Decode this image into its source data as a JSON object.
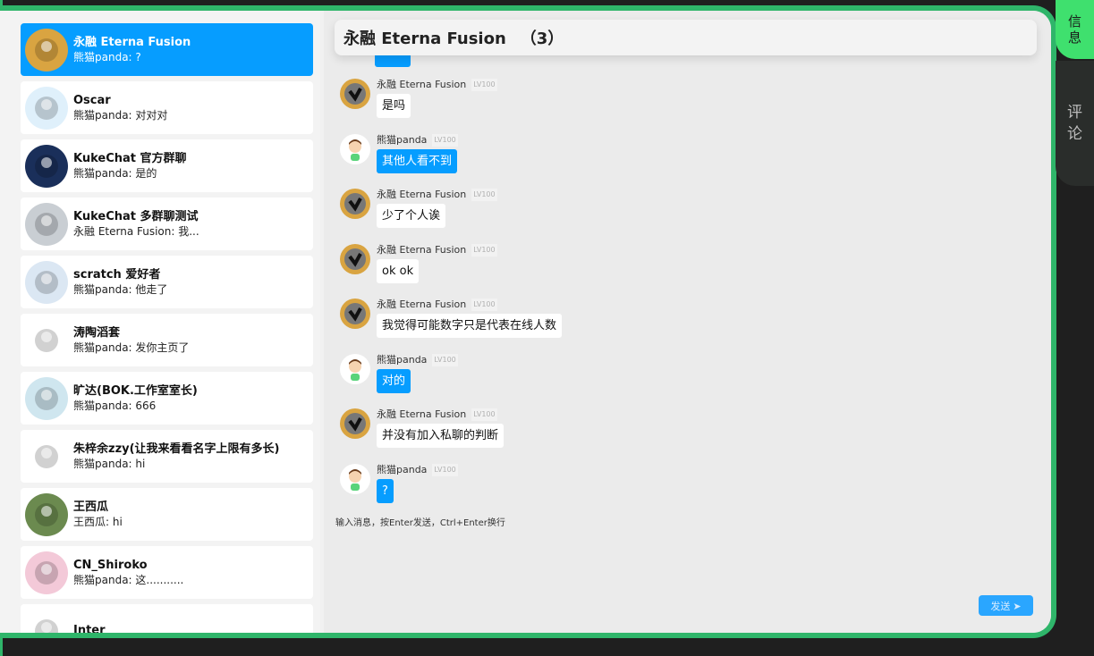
{
  "window": {
    "tab_info_chars": [
      "信",
      "息"
    ],
    "tab_comment_chars": [
      "评",
      "论"
    ]
  },
  "conversations": [
    {
      "name": "永融 Eterna Fusion",
      "last": "熊猫panda: ?",
      "active": true,
      "avatar_icon": "fusion-logo-icon",
      "avatar_color": "#d9a441"
    },
    {
      "name": "Oscar",
      "last": "熊猫panda: 对对对",
      "avatar_icon": "boy-avatar-icon",
      "avatar_color": "#dff0fb"
    },
    {
      "name": "KukeChat 官方群聊",
      "last": "熊猫panda: 是的",
      "avatar_icon": "island-avatar-icon",
      "avatar_color": "#1a2f5a"
    },
    {
      "name": "KukeChat 多群聊测试",
      "last": "永融 Eterna Fusion: 我...",
      "avatar_icon": "robot-avatar-icon",
      "avatar_color": "#c9ced3"
    },
    {
      "name": "scratch 爱好者",
      "last": "熊猫panda: 他走了",
      "avatar_icon": "windows-logo-icon",
      "avatar_color": "#dbe7f3"
    },
    {
      "name": "涛陶滔套",
      "last": "熊猫panda: 发你主页了",
      "avatar_icon": "sketch-avatar-icon",
      "avatar_color": "#ffffff"
    },
    {
      "name": "旷达(BOK.工作室室长)",
      "last": "熊猫panda: 666",
      "avatar_icon": "sky-avatar-icon",
      "avatar_color": "#cfe6ef"
    },
    {
      "name": "朱梓余zzy(让我来看看名字上限有多长)",
      "last": "熊猫panda: hi",
      "avatar_icon": "watermelon-avatar-icon",
      "avatar_color": "#ffffff"
    },
    {
      "name": "王西瓜",
      "last": "王西瓜: hi",
      "avatar_icon": "dog-avatar-icon",
      "avatar_color": "#6b8a4f"
    },
    {
      "name": "CN_Shiroko",
      "last": "熊猫panda: 这...........",
      "avatar_icon": "anime-avatar-icon",
      "avatar_color": "#f3c9d8"
    },
    {
      "name": "Inter",
      "last": "",
      "avatar_icon": "inter-logo-icon",
      "avatar_color": "#ffffff"
    }
  ],
  "chat": {
    "title": "永融 Eterna Fusion",
    "count": "（3）",
    "messages": [
      {
        "sender": "永融 Eterna Fusion",
        "level": "LV100",
        "text": "是吗",
        "mine": false
      },
      {
        "sender": "熊猫panda",
        "level": "LV100",
        "text": "其他人看不到",
        "mine": true
      },
      {
        "sender": "永融 Eterna Fusion",
        "level": "LV100",
        "text": "少了个人诶",
        "mine": false
      },
      {
        "sender": "永融 Eterna Fusion",
        "level": "LV100",
        "text": "ok ok",
        "mine": false
      },
      {
        "sender": "永融 Eterna Fusion",
        "level": "LV100",
        "text": "我觉得可能数字只是代表在线人数",
        "mine": false
      },
      {
        "sender": "熊猫panda",
        "level": "LV100",
        "text": "对的",
        "mine": true
      },
      {
        "sender": "永融 Eterna Fusion",
        "level": "LV100",
        "text": "并没有加入私聊的判断",
        "mine": false
      },
      {
        "sender": "熊猫panda",
        "level": "LV100",
        "text": "?",
        "mine": true
      }
    ],
    "input_placeholder": "输入消息，按Enter发送，Ctrl+Enter换行",
    "send_label": "发送 ➤"
  },
  "colors": {
    "accent_blue": "#069dff",
    "frame_green": "#2fb56a",
    "tab_green": "#3fe06e"
  }
}
